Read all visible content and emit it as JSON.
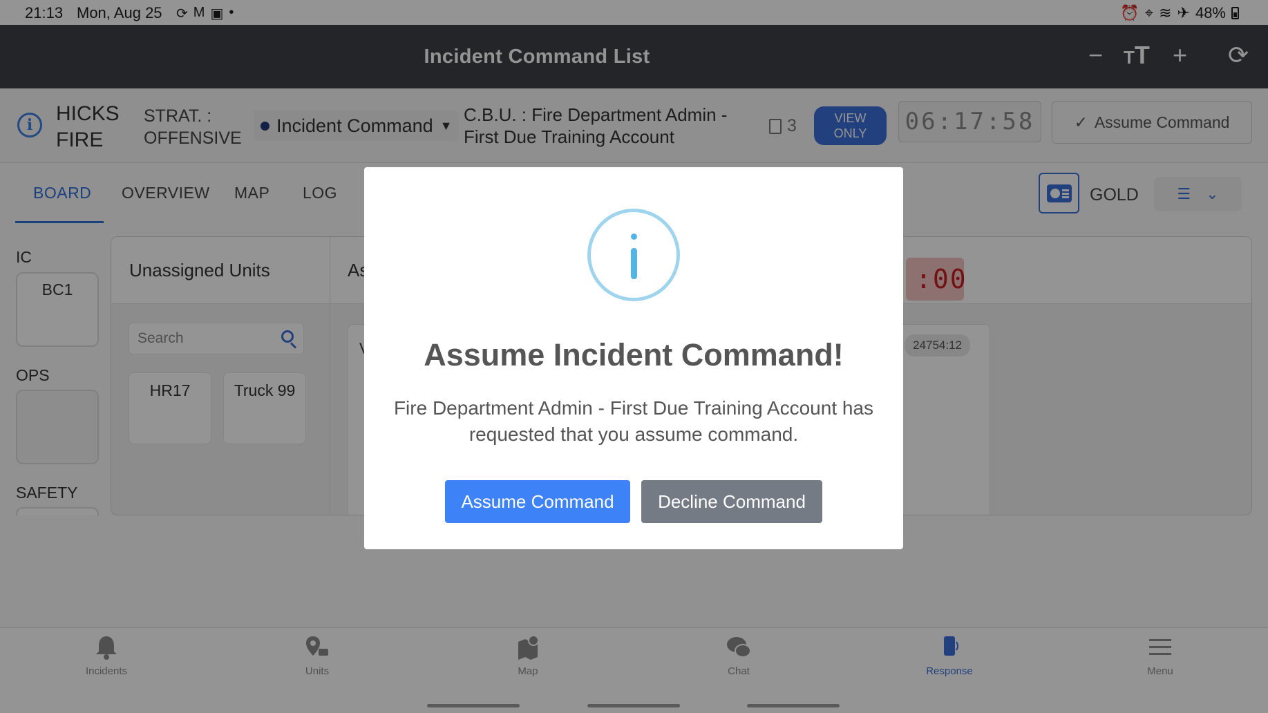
{
  "status_bar": {
    "time": "21:13",
    "date": "Mon, Aug 25",
    "battery": "48%"
  },
  "app_bar": {
    "title": "Incident Command List"
  },
  "incident": {
    "name": "HICKS FIRE",
    "strategy": "STRAT. : OFFENSIVE",
    "command_role": "Incident Command",
    "cbu": "C.B.U. : Fire Department Admin - First Due Training Account",
    "doc_count": "3",
    "view_only": "VIEW ONLY",
    "timer": "06:17:58",
    "assume_command": "Assume Command"
  },
  "tabs": [
    {
      "label": "BOARD",
      "active": true
    },
    {
      "label": "OVERVIEW",
      "active": false
    },
    {
      "label": "MAP",
      "active": false
    },
    {
      "label": "LOG",
      "active": false
    }
  ],
  "channel": "GOLD",
  "lanes": {
    "ic_label": "IC",
    "ic_unit": "BC1",
    "ops_label": "OPS",
    "safety_label": "SAFETY"
  },
  "board": {
    "unassigned_title": "Unassigned Units",
    "assigned_title_partial": "As",
    "search_placeholder": "Search",
    "units": [
      "HR17",
      "Truck 99"
    ],
    "red_timer": ":00",
    "card_letter": "V",
    "card_stamp": "24754:12"
  },
  "modal": {
    "title": "Assume Incident Command!",
    "message": "Fire Department Admin - First Due Training Account has requested that you assume command.",
    "assume_label": "Assume Command",
    "decline_label": "Decline Command"
  },
  "bottom_nav": [
    {
      "label": "Incidents",
      "icon": "bell-icon",
      "active": false
    },
    {
      "label": "Units",
      "icon": "units-map-pin-icon",
      "active": false
    },
    {
      "label": "Map",
      "icon": "map-pin-icon",
      "active": false
    },
    {
      "label": "Chat",
      "icon": "chat-bubbles-icon",
      "active": false
    },
    {
      "label": "Response",
      "icon": "phone-response-icon",
      "active": true
    },
    {
      "label": "Menu",
      "icon": "hamburger-menu-icon",
      "active": false
    }
  ],
  "colors": {
    "accent": "#3b6fd8",
    "header_bg": "#3d4148",
    "assume_button": "#3e82f7",
    "decline_button": "#747b84",
    "info_ring": "#9fd4ef"
  }
}
